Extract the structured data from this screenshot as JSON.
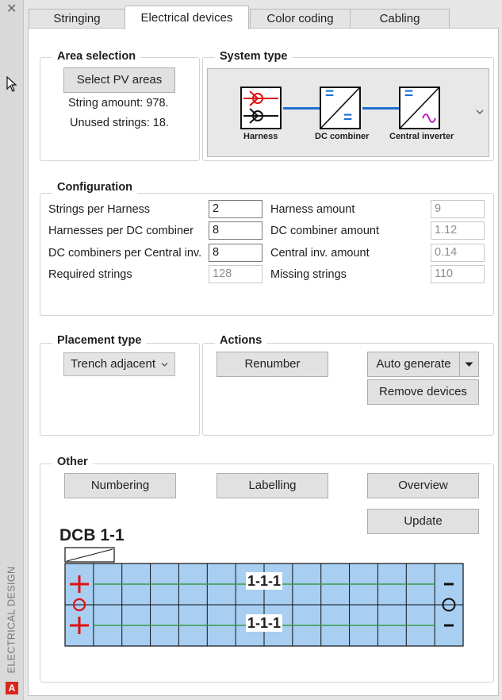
{
  "sidebar": {
    "close": "✕",
    "vertical_title": "ELECTRICAL DESIGN",
    "logo": "A"
  },
  "tabs": [
    {
      "label": "Stringing"
    },
    {
      "label": "Electrical devices"
    },
    {
      "label": "Color coding"
    },
    {
      "label": "Cabling"
    }
  ],
  "area": {
    "title": "Area selection",
    "button": "Select PV areas",
    "string_amount": "String amount: 978.",
    "unused": "Unused strings: 18."
  },
  "system": {
    "title": "System type",
    "harness": "Harness",
    "dc_combiner": "DC combiner",
    "central_inverter": "Central inverter",
    "equals": "="
  },
  "config": {
    "title": "Configuration",
    "left": [
      {
        "label": "Strings per Harness",
        "value": "2"
      },
      {
        "label": "Harnesses per DC combiner",
        "value": "8"
      },
      {
        "label": "DC combiners per Central inv.",
        "value": "8"
      },
      {
        "label": "Required strings",
        "value": "128"
      }
    ],
    "right": [
      {
        "label": "Harness amount",
        "value": "9"
      },
      {
        "label": "DC combiner amount",
        "value": "1.12"
      },
      {
        "label": "Central inv. amount",
        "value": "0.14"
      },
      {
        "label": "Missing strings",
        "value": "110"
      }
    ]
  },
  "placement": {
    "title": "Placement type",
    "selected": "Trench adjacent"
  },
  "actions": {
    "title": "Actions",
    "renumber": "Renumber",
    "auto_generate": "Auto generate",
    "remove_devices": "Remove devices"
  },
  "other": {
    "title": "Other",
    "numbering": "Numbering",
    "labelling": "Labelling",
    "overview": "Overview",
    "update": "Update"
  },
  "diagram": {
    "title": "DCB 1-1",
    "row_label_1": "1-1-1",
    "row_label_2": "1-1-1",
    "plus": "+",
    "minus": "−",
    "grid_color": "#a8cef2",
    "wire_color": "#3b9a4a",
    "accent_red": "#e01010"
  }
}
